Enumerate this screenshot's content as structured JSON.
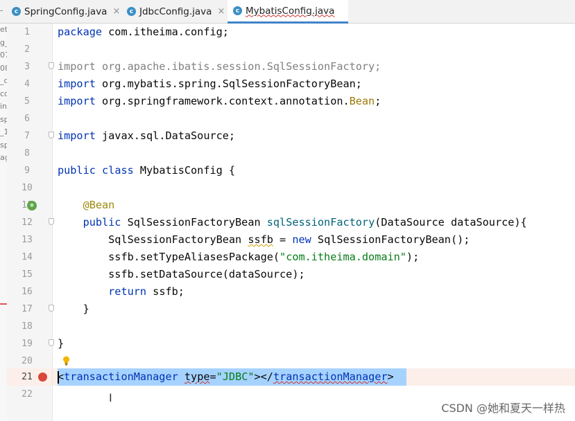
{
  "tabs": [
    {
      "label": "SpringConfig.java",
      "active": false,
      "squiggle": false
    },
    {
      "label": "JdbcConfig.java",
      "active": false,
      "squiggle": false
    },
    {
      "label": "MybatisConfig.java",
      "active": true,
      "squiggle": true
    }
  ],
  "tab_close_glyph": "×",
  "tabbar_stub": "-",
  "project_tree_fragments": [
    "et",
    "g_",
    "07",
    "08",
    "_c",
    "co",
    "in",
    "sp",
    "_1",
    "sp",
    "ag"
  ],
  "line_numbers": [
    "1",
    "2",
    "3",
    "4",
    "5",
    "6",
    "7",
    "8",
    "9",
    "10",
    "11",
    "12",
    "13",
    "14",
    "15",
    "16",
    "17",
    "18",
    "19",
    "20",
    "21",
    "22"
  ],
  "current_line": "21",
  "code": {
    "l1": {
      "kw": "package",
      "rest": " com.itheima.config;"
    },
    "l3": {
      "text": "import org.apache.ibatis.session.SqlSessionFactory;"
    },
    "l4": {
      "kw": "import",
      "rest": " org.mybatis.spring.SqlSessionFactoryBean;"
    },
    "l5": {
      "kw": "import",
      "rest": " org.springframework.context.annotation.",
      "bean": "Bean",
      "end": ";"
    },
    "l7": {
      "kw": "import",
      "rest": " javax.sql.DataSource;"
    },
    "l9": {
      "kw1": "public",
      "kw2": "class",
      "rest": " MybatisConfig {"
    },
    "l11": {
      "ann": "@Bean"
    },
    "l12": {
      "kw": "public",
      "type": " SqlSessionFactoryBean ",
      "fn": "sqlSessionFactory",
      "rest": "(DataSource dataSource){"
    },
    "l13": {
      "a": "SqlSessionFactoryBean ",
      "var": "ssfb",
      "b": " = ",
      "kw": "new",
      "c": " SqlSessionFactoryBean();"
    },
    "l14": {
      "a": "ssfb.setTypeAliasesPackage(",
      "str": "\"com.itheima.domain\"",
      "b": ");"
    },
    "l15": {
      "a": "ssfb.setDataSource(dataSource);"
    },
    "l16": {
      "kw": "return",
      "rest": " ssfb;"
    },
    "l17": {
      "text": "}"
    },
    "l19": {
      "text": "}"
    },
    "l21": {
      "a": "<",
      "tag": "transactionManager",
      "b": " ",
      "attr": "type",
      "c": "=",
      "str": "\"JDBC\"",
      "d": "></",
      "tag2": "transactionManager",
      "e": ">"
    }
  },
  "cursor_glyph": "I",
  "watermark": "CSDN @她和夏天一样热",
  "colors": {
    "keyword": "#0033b3",
    "string": "#067d17",
    "annotation": "#9e880d",
    "selection": "#a6d2ff",
    "breakpoint": "#d9463a",
    "tab_accent": "#4083c9"
  }
}
